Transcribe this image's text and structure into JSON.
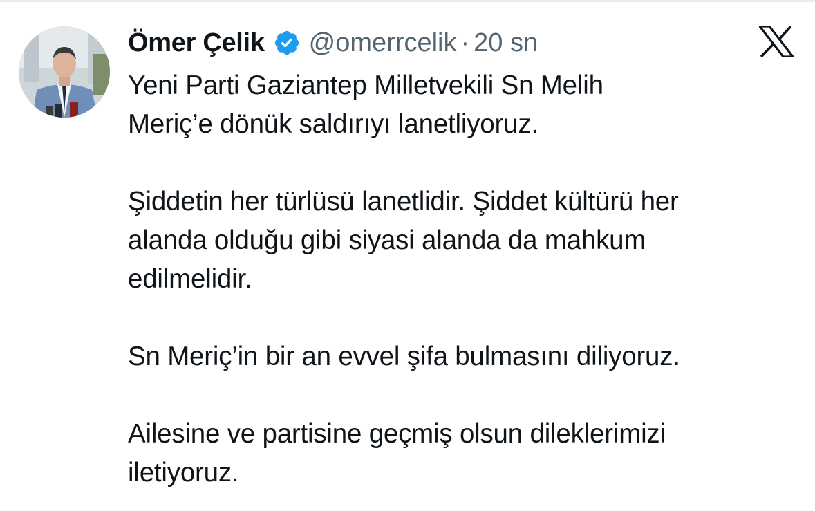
{
  "tweet": {
    "display_name": "Ömer Çelik",
    "handle": "@omerrcelik",
    "separator": "·",
    "timestamp": "20 sn",
    "verified": true,
    "avatar_icon": "profile-photo",
    "platform_icon": "x-logo-icon",
    "colors": {
      "verified_badge": "#1d9bf0",
      "muted_text": "#536471",
      "primary_text": "#0f1419"
    },
    "paragraphs": [
      {
        "lines": [
          "Yeni Parti Gaziantep Milletvekili Sn Melih",
          "Meriç’e dönük saldırıyı lanetliyoruz."
        ]
      },
      {
        "lines": [
          "Şiddetin her türlüsü lanetlidir. Şiddet kültürü her",
          "alanda olduğu gibi siyasi alanda da mahkum",
          "edilmelidir."
        ]
      },
      {
        "lines": [
          "Sn Meriç’in bir an evvel şifa bulmasını diliyoruz."
        ]
      },
      {
        "lines": [
          "Ailesine ve partisine geçmiş olsun dileklerimizi",
          "iletiyoruz."
        ]
      }
    ]
  }
}
